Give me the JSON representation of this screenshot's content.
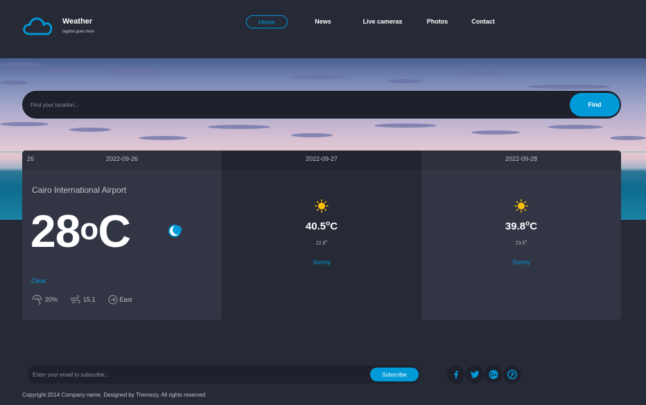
{
  "brand": {
    "title": "Weather",
    "tagline": "tagline goes here"
  },
  "nav": [
    {
      "label": "Home",
      "active": true
    },
    {
      "label": "News",
      "active": false
    },
    {
      "label": "Live cameras",
      "active": false
    },
    {
      "label": "Photos",
      "active": false
    },
    {
      "label": "Contact",
      "active": false
    }
  ],
  "search": {
    "placeholder": "Find your location...",
    "button_label": "Find"
  },
  "today": {
    "day_num": "26",
    "date": "2022-09-26",
    "location": "Cairo International Airport",
    "temp_value": "28",
    "temp_degree": "o",
    "temp_unit": "C",
    "icon": "moon-icon",
    "condition": "Clear",
    "rain": "20%",
    "wind": "15.1",
    "wind_direction": "East"
  },
  "forecast": [
    {
      "date": "2022-09-27",
      "icon": "sun-icon",
      "temp_value": "40.5",
      "temp_degree": "o",
      "temp_unit": "C",
      "min_value": "22.8",
      "min_degree": "o",
      "condition": "Sunny"
    },
    {
      "date": "2022-09-28",
      "icon": "sun-icon",
      "temp_value": "39.8",
      "temp_degree": "o",
      "temp_unit": "C",
      "min_value": "23.5",
      "min_degree": "o",
      "condition": "Sunny"
    }
  ],
  "footer": {
    "subscribe_placeholder": "Enter your email to subscribe...",
    "subscribe_label": "Subscribe",
    "social": [
      "facebook-icon",
      "twitter-icon",
      "google-plus-icon",
      "pinterest-icon"
    ],
    "copyright": "Copyright 2014 Company name. Designed by Themezy. All rights reserved"
  },
  "colors": {
    "accent": "#009ad8",
    "background": "#262936",
    "panel": "#323544",
    "sun": "#ffc107"
  }
}
